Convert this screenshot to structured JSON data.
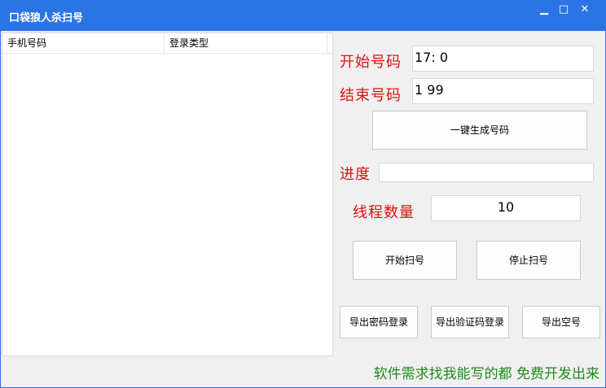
{
  "window": {
    "title": "口袋狼人杀扫号",
    "minimize_glyph": "▁",
    "maximize_glyph": "□",
    "close_glyph": "✕"
  },
  "list": {
    "columns": [
      "手机号码",
      "登录类型"
    ],
    "rows": []
  },
  "form": {
    "start_label": "开始号码",
    "start_value": "17:     0",
    "end_label": "结束号码",
    "end_value": "1       99",
    "generate_button": "一键生成号码",
    "progress_label": "进度",
    "progress_value": "",
    "threads_label": "线程数量",
    "threads_value": "10",
    "start_scan_button": "开始扫号",
    "stop_scan_button": "停止扫号",
    "export_password_button": "导出密码登录",
    "export_sms_button": "导出验证码登录",
    "export_empty_button": "导出空号"
  },
  "marquee": {
    "text": "软件需求找我能写的都   免费开发出来"
  },
  "colors": {
    "titlebar": "#2b74e6",
    "label_red": "#e01010",
    "marquee_green": "#1f8a1f"
  }
}
